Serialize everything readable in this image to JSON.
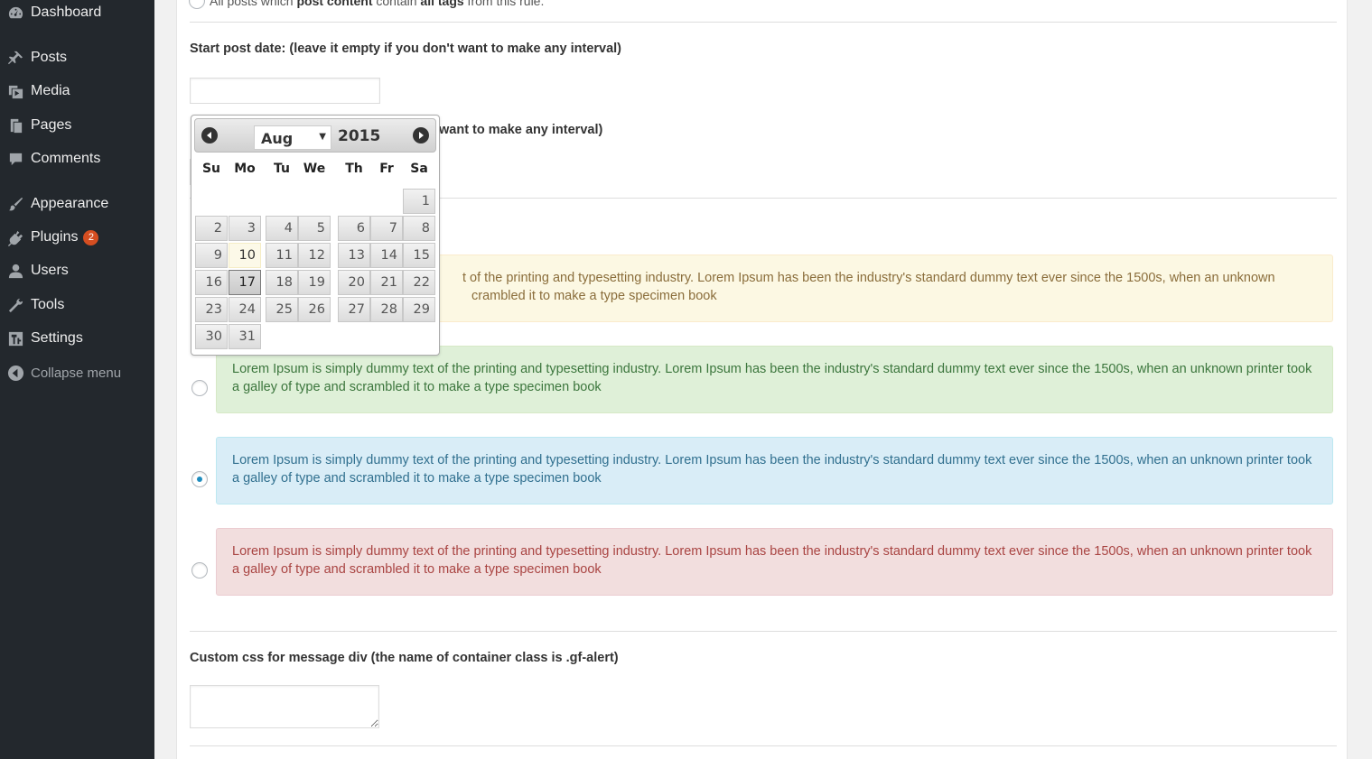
{
  "sidebar": {
    "items": [
      {
        "label": "Dashboard",
        "icon": "dashboard-icon"
      },
      {
        "label": "Posts",
        "icon": "pin-icon"
      },
      {
        "label": "Media",
        "icon": "media-icon"
      },
      {
        "label": "Pages",
        "icon": "pages-icon"
      },
      {
        "label": "Comments",
        "icon": "comment-icon"
      },
      {
        "label": "Appearance",
        "icon": "brush-icon"
      },
      {
        "label": "Plugins",
        "icon": "plugin-icon",
        "badge": "2"
      },
      {
        "label": "Users",
        "icon": "user-icon"
      },
      {
        "label": "Tools",
        "icon": "wrench-icon"
      },
      {
        "label": "Settings",
        "icon": "settings-icon"
      }
    ],
    "collapse_label": "Collapse menu"
  },
  "form": {
    "top_option": {
      "prefix": "All posts which ",
      "bold1": "post content",
      "middle": " contain ",
      "bold2": "all tags",
      "suffix": " from this rule."
    },
    "start_date_label": "Start post date: (leave it empty if you don't want to make any interval)",
    "start_date_value": "",
    "end_date_label_visible": "want to make any interval)",
    "alerts": [
      {
        "type": "warning",
        "text_partial": "t of the printing and typesetting industry. Lorem Ipsum has been the industry's standard dummy text ever since the 1500s, when an unknown",
        "text_partial_line2": "crambled it to make a type specimen book"
      },
      {
        "type": "success",
        "text": "Lorem Ipsum is simply dummy text of the printing and typesetting industry. Lorem Ipsum has been the industry's standard dummy text ever since the 1500s, when an unknown printer took a galley of type and scrambled it to make a type specimen book",
        "checked": false
      },
      {
        "type": "info",
        "text": "Lorem Ipsum is simply dummy text of the printing and typesetting industry. Lorem Ipsum has been the industry's standard dummy text ever since the 1500s, when an unknown printer took a galley of type and scrambled it to make a type specimen book",
        "checked": true
      },
      {
        "type": "danger",
        "text": "Lorem Ipsum is simply dummy text of the printing and typesetting industry. Lorem Ipsum has been the industry's standard dummy text ever since the 1500s, when an unknown printer took a galley of type and scrambled it to make a type specimen book",
        "checked": false
      }
    ],
    "custom_css_label": "Custom css for message div (the name of container class is .gf-alert)",
    "custom_css_value": ""
  },
  "datepicker": {
    "month": "Aug",
    "year": "2015",
    "weekdays": [
      "Su",
      "Mo",
      "Tu",
      "We",
      "Th",
      "Fr",
      "Sa"
    ],
    "first_weekday_index": 6,
    "days_in_month": 31,
    "today": 10,
    "selected": 17
  },
  "colors": {
    "sidebar_bg": "#23282d",
    "accent": "#1e8cbe",
    "badge": "#d54e21"
  }
}
